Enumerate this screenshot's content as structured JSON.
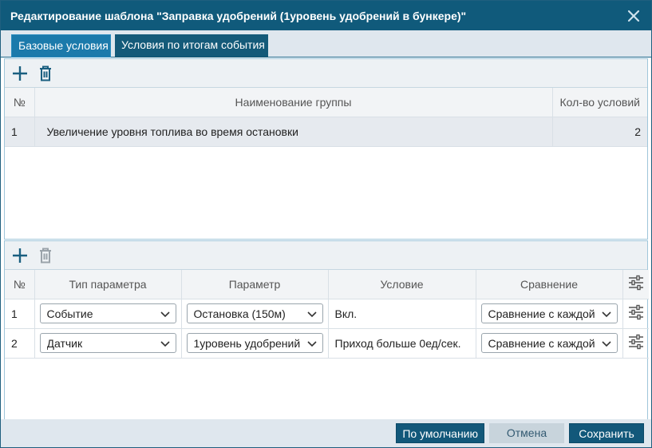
{
  "dialog": {
    "title": "Редактирование шаблона \"Заправка удобрений (1уровень удобрений в бункере)\"",
    "close_icon": "close-icon"
  },
  "tabs": [
    {
      "label": "Базовые условия",
      "active": true
    },
    {
      "label": "Условия по итогам события",
      "active": false
    }
  ],
  "groups": {
    "add_icon": "plus-icon",
    "delete_icon": "trash-icon",
    "columns": {
      "num": "№",
      "name": "Наименование группы",
      "count": "Кол-во условий"
    },
    "rows": [
      {
        "num": "1",
        "name": "Увеличение уровня топлива во время остановки",
        "count": "2"
      }
    ]
  },
  "conditions": {
    "add_icon": "plus-icon",
    "delete_icon": "trash-icon",
    "columns": {
      "num": "№",
      "param_type": "Тип параметра",
      "param": "Параметр",
      "condition": "Условие",
      "compare": "Сравнение",
      "settings_icon": "sliders-icon"
    },
    "rows": [
      {
        "num": "1",
        "param_type": "Событие",
        "param": "Остановка (150м)",
        "condition": "Вкл.",
        "compare": "Сравнение с каждой"
      },
      {
        "num": "2",
        "param_type": "Датчик",
        "param": "1уровень удобрений",
        "condition": "Приход больше 0ед/сек.",
        "compare": "Сравнение с каждой"
      }
    ]
  },
  "footer": {
    "default_label": "По умолчанию",
    "cancel_label": "Отмена",
    "save_label": "Сохранить"
  },
  "colors": {
    "title_bar": "#105a7b",
    "accent": "#1b7aab",
    "selected_row": "#e6eaef"
  }
}
